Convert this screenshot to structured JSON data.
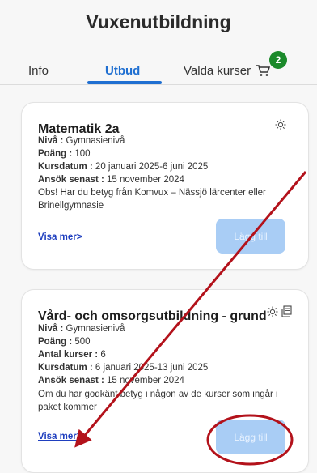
{
  "header": {
    "title": "Vuxenutbildning"
  },
  "tabs": {
    "info": "Info",
    "utbud": "Utbud",
    "valda": "Valda kurser",
    "cart_count": "2"
  },
  "courses": [
    {
      "title": "Matematik 2a",
      "niva_label": "Nivå :",
      "niva": " Gymnasienivå",
      "poang_label": "Poäng :",
      "poang": " 100",
      "datum_label": "Kursdatum :",
      "datum": " 20 januari 2025-6 juni 2025",
      "ansok_label": "Ansök senast :",
      "ansok": " 15 november 2024",
      "note": "Obs! Har du betyg från Komvux – Nässjö lärcenter eller Brinellgymnasie",
      "link": "Visa mer>",
      "button": "Lägg till"
    },
    {
      "title": "Vård- och omsorgsutbildning - grund",
      "niva_label": "Nivå :",
      "niva": " Gymnasienivå",
      "poang_label": "Poäng :",
      "poang": " 500",
      "antal_label": "Antal kurser :",
      "antal": " 6",
      "datum_label": "Kursdatum :",
      "datum": " 6 januari 2025-13 juni 2025",
      "ansok_label": "Ansök senast :",
      "ansok": " 15 november 2024",
      "note": "Om du har godkänt betyg i någon av de kurser som ingår i paket kommer",
      "link": "Visa mer>",
      "button": "Lägg till"
    }
  ],
  "icons": {
    "sun": "sun-icon",
    "copy": "copy-icon",
    "cart": "cart-icon"
  },
  "colors": {
    "accent": "#1f6fd1",
    "badge": "#1b8a2b",
    "annotation": "#b3121b",
    "button_disabled": "#a9cdf5"
  }
}
